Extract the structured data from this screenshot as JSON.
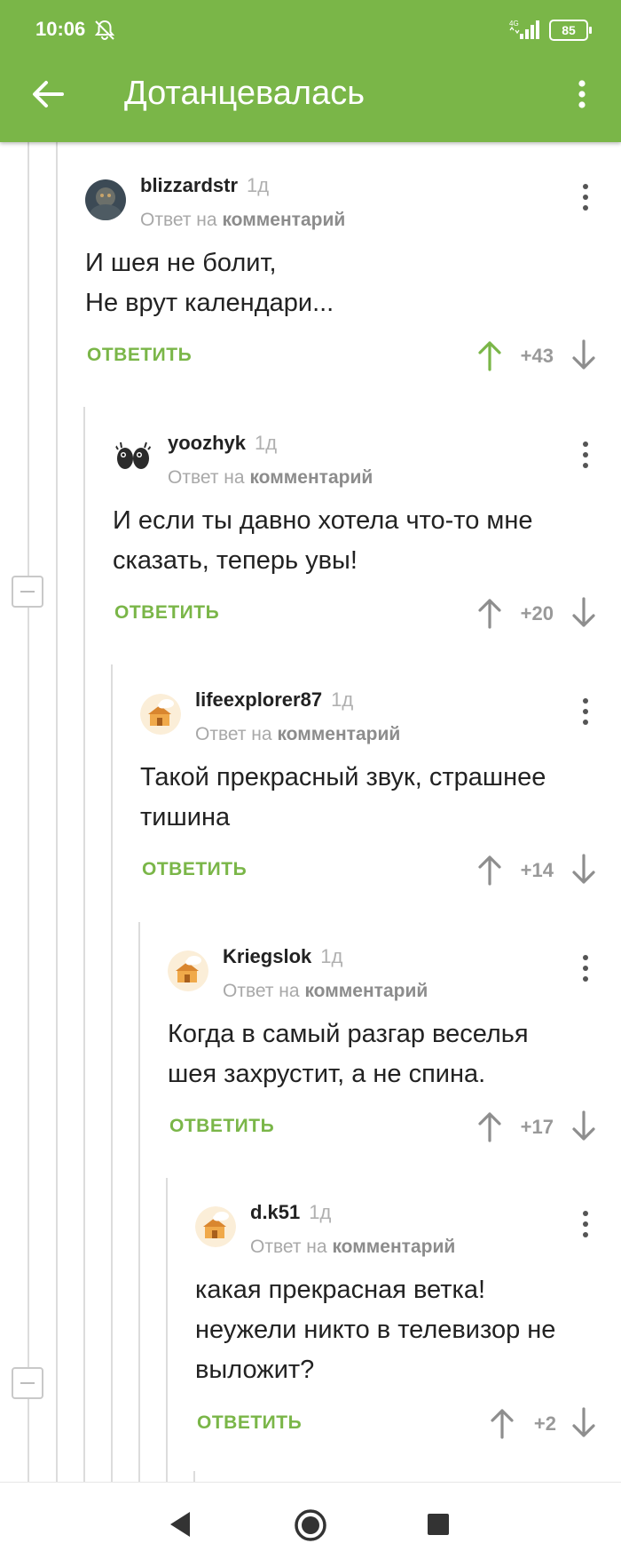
{
  "status_bar": {
    "time": "10:06",
    "network": "4G",
    "battery": "85"
  },
  "app_bar": {
    "title": "Дотанцевалась",
    "accent_color": "#7ab648"
  },
  "labels": {
    "reply_to_prefix": "Ответ на",
    "reply_to_target": "комментарий",
    "reply_button": "ОТВЕТИТЬ"
  },
  "comments": [
    {
      "username": "blizzardstr",
      "time": "1д",
      "text_lines": [
        "И шея не болит,",
        "Не врут календари..."
      ],
      "score": "+43",
      "upvoted": true
    },
    {
      "username": "yoozhyk",
      "time": "1д",
      "text_lines": [
        "И если ты давно хотела что-то мне",
        "сказать, теперь увы!"
      ],
      "score": "+20",
      "upvoted": false
    },
    {
      "username": "lifeexplorer87",
      "time": "1д",
      "text_lines": [
        "Такой прекрасный звук, страшнее",
        "тишина"
      ],
      "score": "+14",
      "upvoted": false
    },
    {
      "username": "Kriegslok",
      "time": "1д",
      "text_lines": [
        "Когда в самый разгар веселья",
        "шея захрустит, а не спина."
      ],
      "score": "+17",
      "upvoted": false
    },
    {
      "username": "d.k51",
      "time": "1д",
      "text_lines": [
        "какая прекрасная ветка!",
        "неужели никто в телевизор не",
        "выложит?"
      ],
      "score": "+2",
      "upvoted": false
    }
  ]
}
